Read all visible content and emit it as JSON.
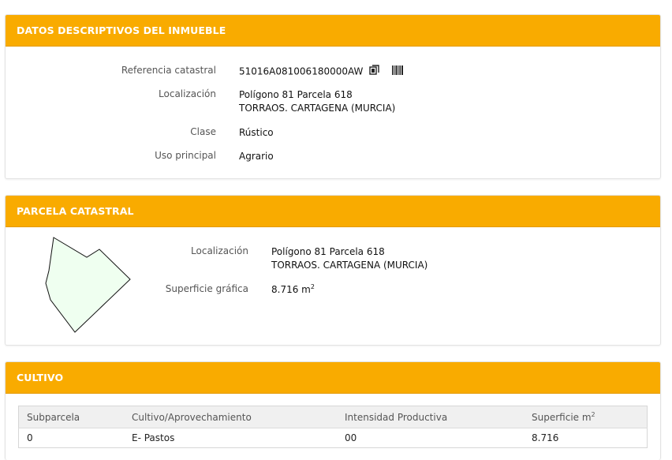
{
  "datos": {
    "title": "DATOS DESCRIPTIVOS DEL INMUEBLE",
    "ref_label": "Referencia catastral",
    "ref_value": "51016A081006180000AW",
    "loc_label": "Localización",
    "loc_line1": "Polígono 81 Parcela 618",
    "loc_line2": "TORRAOS. CARTAGENA (MURCIA)",
    "clase_label": "Clase",
    "clase_value": "Rústico",
    "uso_label": "Uso principal",
    "uso_value": "Agrario"
  },
  "parcela": {
    "title": "PARCELA CATASTRAL",
    "loc_label": "Localización",
    "loc_line1": "Polígono 81 Parcela 618",
    "loc_line2": "TORRAOS. CARTAGENA (MURCIA)",
    "sup_label": "Superficie gráfica",
    "sup_value": "8.716 m",
    "sup_exp": "2"
  },
  "cultivo": {
    "title": "CULTIVO",
    "headers": [
      "Subparcela",
      "Cultivo/Aprovechamiento",
      "Intensidad Productiva",
      "Superficie m"
    ],
    "header_exp": "2",
    "rows": [
      [
        "0",
        "E- Pastos",
        "00",
        "8.716"
      ]
    ]
  },
  "icons": [
    "copy-icon",
    "barcode-icon"
  ],
  "colors": {
    "header_bg": "#f9ab00",
    "parcel_fill": "#effff0"
  }
}
